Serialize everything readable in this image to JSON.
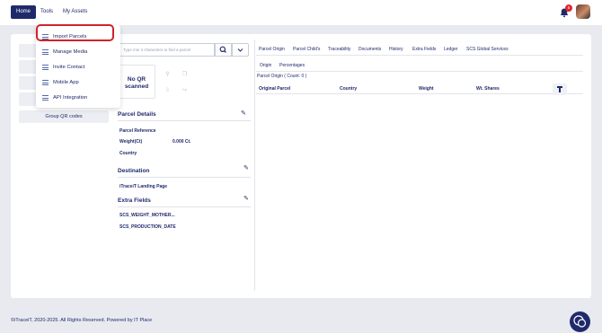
{
  "nav": {
    "home": "Home",
    "tools": "Tools",
    "my_assets": "My Assets",
    "notification_count": "5"
  },
  "tools_menu": {
    "items": [
      {
        "label": "Import Parcels"
      },
      {
        "label": "Manage Media"
      },
      {
        "label": "Invite Contact"
      },
      {
        "label": "Mobile App"
      },
      {
        "label": "API Integration"
      }
    ],
    "highlighted": "Import Parcels"
  },
  "left_panel": {
    "group_qr_codes": "Group QR codes"
  },
  "search": {
    "placeholder": "Type min 3 characters to find a parcel"
  },
  "qr": {
    "status_line1": "No QR",
    "status_line2": "scanned"
  },
  "parcel_details": {
    "title": "Parcel Details",
    "fields": {
      "reference": "Parcel Reference",
      "weight_label": "Weight(Ct)",
      "weight_value": "0.000 Ct.",
      "country": "Country"
    }
  },
  "destination": {
    "title": "Destination",
    "landing_page": "iTraceiT Landing Page"
  },
  "extra_fields": {
    "title": "Extra Fields",
    "field1": "SCS_WEIGHT_MOTHER...",
    "field2": "SCS_PRODUCTION_DATE"
  },
  "tabs": [
    "Parcel Origin",
    "Parcel Child's",
    "Traceability",
    "Documents",
    "History",
    "Extra Fields",
    "Ledger",
    "SCS Global Services"
  ],
  "active_tab": "Parcel Origin",
  "subtabs": [
    "Origin",
    "Percentages"
  ],
  "active_subtab": "Origin",
  "origin_count": "Parcel Origin ( Count: 0 )",
  "table": {
    "headers": [
      "Original Parcel",
      "Country",
      "Weight",
      "Wt. Shares"
    ]
  },
  "footer": "©iTraceiT, 2020-2025. All Rights Reserved. Powered by IT Place",
  "colors": {
    "primary": "#1f2a6b",
    "highlight": "#d0232a",
    "badge": "#e0262b"
  }
}
